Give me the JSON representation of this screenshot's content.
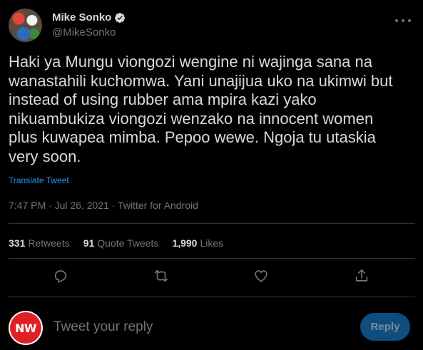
{
  "author": {
    "display_name": "Mike Sonko",
    "handle": "@MikeSonko",
    "verified": true,
    "avatar_icon": "profile-photo"
  },
  "tweet": {
    "text": "Haki ya Mungu viongozi wengine ni wajinga sana na\nwanastahili kuchomwa. Yani unajijua uko na ukimwi but\ninstead of using rubber ama mpira kazi yako\nnikuambukiza viongozi wenzako na innocent women\nplus kuwapea mimba. Pepoo wewe. Ngoja tu utaskia\nvery soon.",
    "translate_label": "Translate Tweet",
    "meta": "7:47 PM · Jul 26, 2021 · Twitter for Android"
  },
  "stats": {
    "retweets_count": "331",
    "retweets_label": "Retweets",
    "quote_count": "91",
    "quote_label": "Quote Tweets",
    "likes_count": "1,990",
    "likes_label": "Likes"
  },
  "actions": {
    "reply_icon": "reply-icon",
    "retweet_icon": "retweet-icon",
    "like_icon": "heart-icon",
    "share_icon": "share-icon"
  },
  "reply": {
    "avatar_text": "NW",
    "placeholder": "Tweet your reply",
    "button_label": "Reply"
  },
  "colors": {
    "background": "#000000",
    "accent": "#1d9bf0",
    "secondary_text": "#6e767d",
    "reply_button": "#0e4d7e",
    "nw_red": "#e01f26"
  }
}
